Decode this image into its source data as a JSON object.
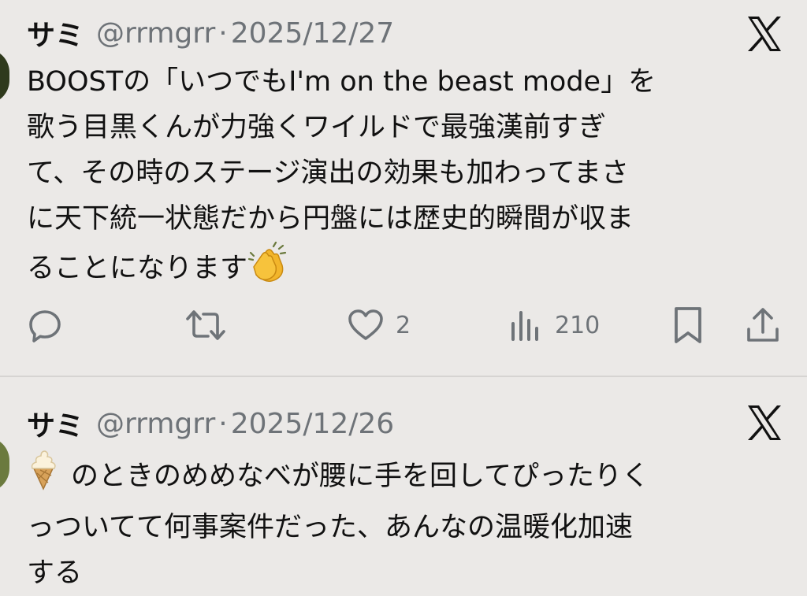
{
  "tweets": [
    {
      "display_name": "サミ",
      "handle": "@rrmgrr",
      "separator": "·",
      "date": "2025/12/27",
      "text": "BOOSTの「いつでもI'm on the beast mode」を\n歌う目黒くんが力強くワイルドで最強漢前すぎ\nて、その時のステージ演出の効果も加わってまさ\nに天下統一状態だから円盤には歴史的瞬間が収ま\nることになります",
      "emoji": "clapping-hands",
      "actions": {
        "reply_icon": "reply-icon",
        "repost_icon": "repost-icon",
        "like_icon": "heart-icon",
        "like_count": "2",
        "views_icon": "views-icon",
        "view_count": "210",
        "bookmark_icon": "bookmark-icon",
        "share_icon": "share-icon"
      }
    },
    {
      "display_name": "サミ",
      "handle": "@rrmgrr",
      "separator": "·",
      "date": "2025/12/26",
      "emoji": "soft-ice-cream",
      "text": "のときのめめなべが腰に手を回してぴったりく\nっついてて何事案件だった、あんなの温暖化加速\nする"
    }
  ],
  "colors": {
    "background": "#ebe9e7",
    "text": "#111111",
    "secondary": "#6e7378"
  }
}
